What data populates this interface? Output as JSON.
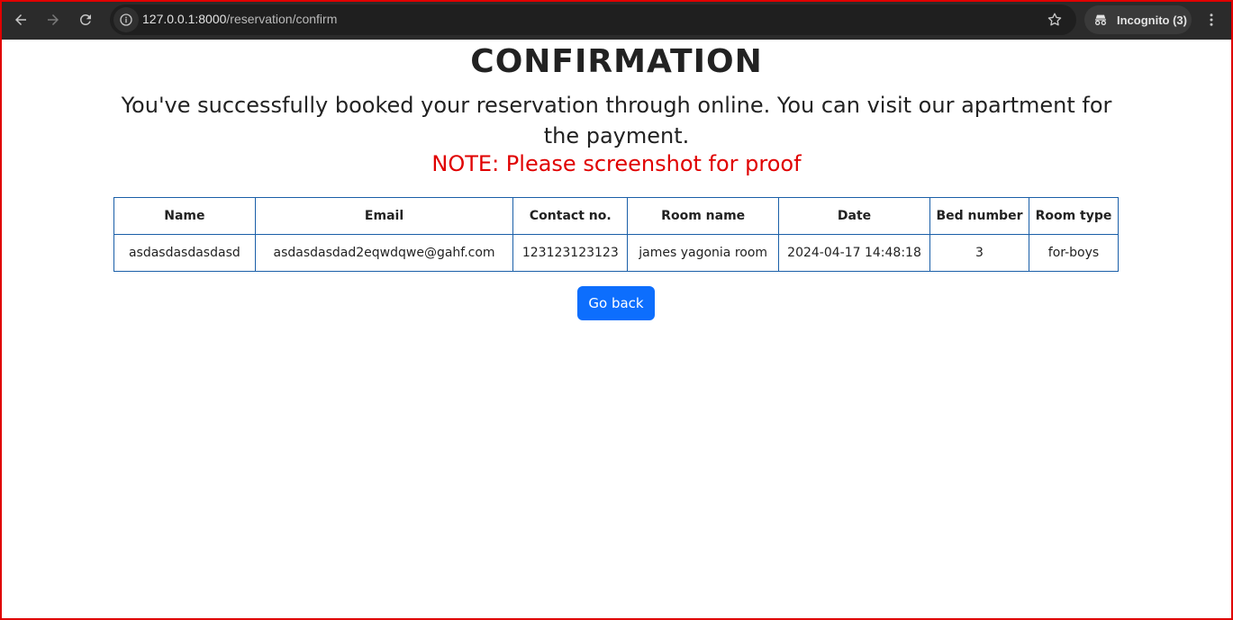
{
  "browser": {
    "url_host": "127.0.0.1:8000",
    "url_path": "/reservation/confirm",
    "incognito_label": "Incognito (3)",
    "icons": [
      "back-arrow-icon",
      "forward-arrow-icon",
      "reload-icon",
      "site-info-icon",
      "star-icon",
      "incognito-icon",
      "kebab-menu-icon"
    ]
  },
  "page": {
    "title": "CONFIRMATION",
    "message": "You've successfully booked your reservation through online. You can visit our apartment for the payment.",
    "note": "NOTE: Please screenshot for proof",
    "note_color": "#e00000"
  },
  "table": {
    "headers": [
      "Name",
      "Email",
      "Contact no.",
      "Room name",
      "Date",
      "Bed number",
      "Room type"
    ],
    "rows": [
      [
        "asdasdasdasdasd",
        "asdasdasdad2eqwdqwe@gahf.com",
        "123123123123",
        "james yagonia room",
        "2024-04-17 14:48:18",
        "3",
        "for-boys"
      ]
    ],
    "border_color": "#1a5fa8"
  },
  "actions": {
    "go_back_label": "Go back",
    "go_back_color": "#0d6efd"
  }
}
